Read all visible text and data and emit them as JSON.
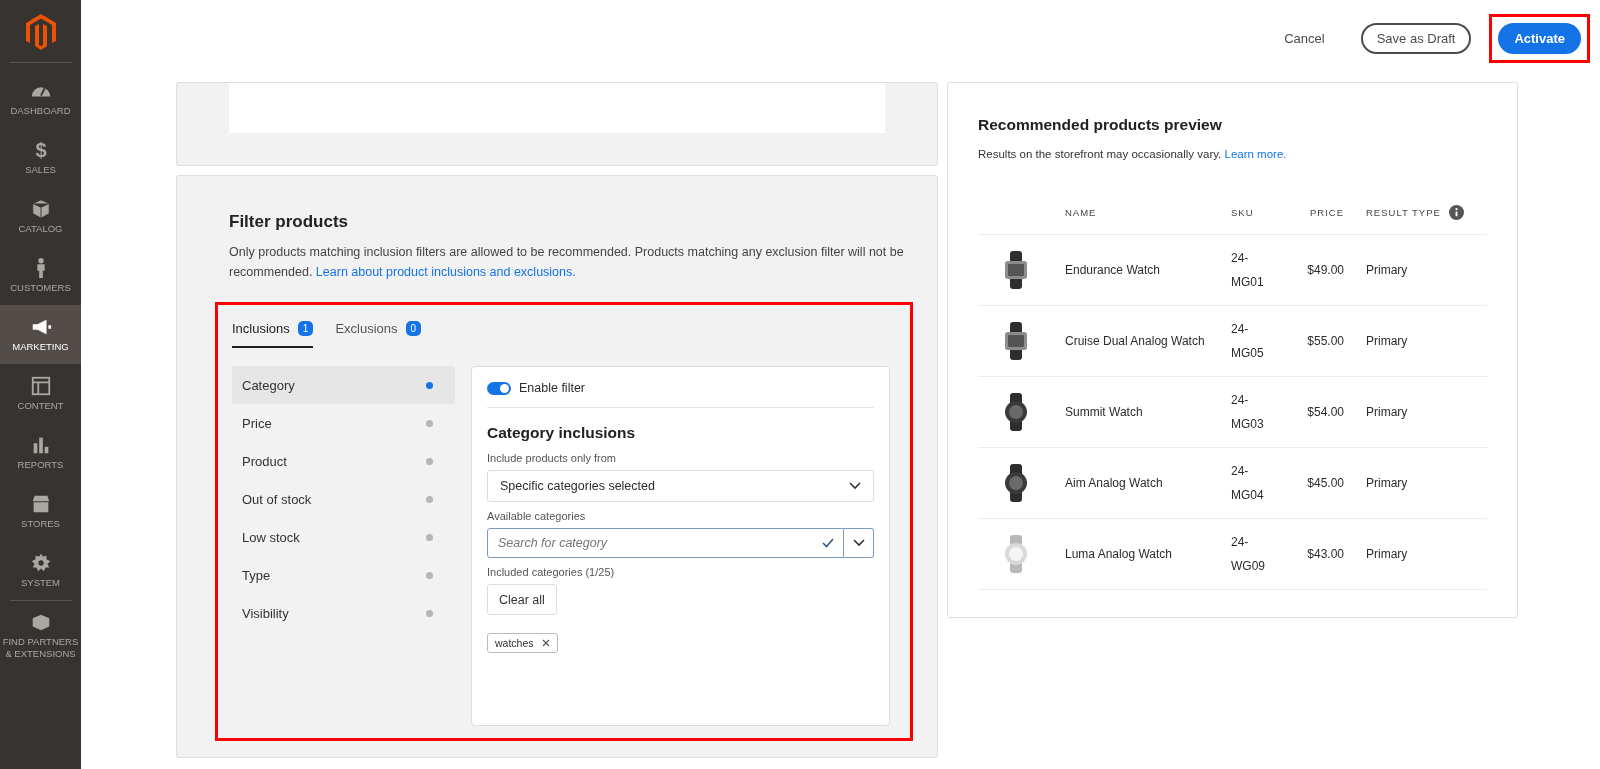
{
  "sidebar": {
    "items": [
      {
        "label": "DASHBOARD",
        "selected": false
      },
      {
        "label": "SALES",
        "selected": false,
        "icon": "$"
      },
      {
        "label": "CATALOG",
        "selected": false
      },
      {
        "label": "CUSTOMERS",
        "selected": false
      },
      {
        "label": "MARKETING",
        "selected": true
      },
      {
        "label": "CONTENT",
        "selected": false
      },
      {
        "label": "REPORTS",
        "selected": false
      },
      {
        "label": "STORES",
        "selected": false
      },
      {
        "label": "SYSTEM",
        "selected": false
      },
      {
        "label": "FIND PARTNERS & EXTENSIONS",
        "selected": false
      }
    ]
  },
  "header": {
    "buttons": [
      {
        "label": "Cancel",
        "kind": "text"
      },
      {
        "label": "Save as Draft",
        "kind": "outline"
      },
      {
        "label": "Activate",
        "kind": "primary"
      }
    ]
  },
  "filter": {
    "title": "Filter products",
    "description": "Only products matching inclusion filters are allowed to be recommended. Products matching any exclusion filter will not be recommended.",
    "link": "Learn about product inclusions and exclusions.",
    "tabs": [
      {
        "label": "Inclusions",
        "count": "1",
        "selected": true
      },
      {
        "label": "Exclusions",
        "count": "0",
        "selected": false
      }
    ],
    "items": [
      {
        "label": "Category",
        "selected": true,
        "active": true
      },
      {
        "label": "Price",
        "selected": false,
        "active": false
      },
      {
        "label": "Product",
        "selected": false,
        "active": false
      },
      {
        "label": "Out of stock",
        "selected": false,
        "active": false
      },
      {
        "label": "Low stock",
        "selected": false,
        "active": false
      },
      {
        "label": "Type",
        "selected": false,
        "active": false
      },
      {
        "label": "Visibility",
        "selected": false,
        "active": false
      }
    ],
    "panel": {
      "toggle": {
        "label": "Enable filter",
        "on": true
      },
      "title": "Category inclusions",
      "include_label": "Include products only from",
      "include_value": "Specific categories selected",
      "available_label": "Available categories",
      "search": {
        "placeholder": "Search for category"
      },
      "included_label": "Included categories (1/25)",
      "clear_button": "Clear all",
      "tags": [
        "watches"
      ]
    }
  },
  "preview": {
    "title": "Recommended products preview",
    "note": "Results on the storefront may occasionally vary.",
    "link": "Learn more.",
    "columns": [
      "NAME",
      "SKU",
      "PRICE",
      "RESULT TYPE"
    ],
    "rows": [
      {
        "name": "Endurance Watch",
        "sku": "24-\nMG01",
        "price": "$49.00",
        "type": "Primary"
      },
      {
        "name": "Cruise Dual Analog Watch",
        "sku": "24-\nMG05",
        "price": "$55.00",
        "type": "Primary"
      },
      {
        "name": "Summit Watch",
        "sku": "24-\nMG03",
        "price": "$54.00",
        "type": "Primary"
      },
      {
        "name": "Aim Analog Watch",
        "sku": "24-\nMG04",
        "price": "$45.00",
        "type": "Primary"
      },
      {
        "name": "Luma Analog Watch",
        "sku": "24-\nWG09",
        "price": "$43.00",
        "type": "Primary"
      }
    ]
  }
}
